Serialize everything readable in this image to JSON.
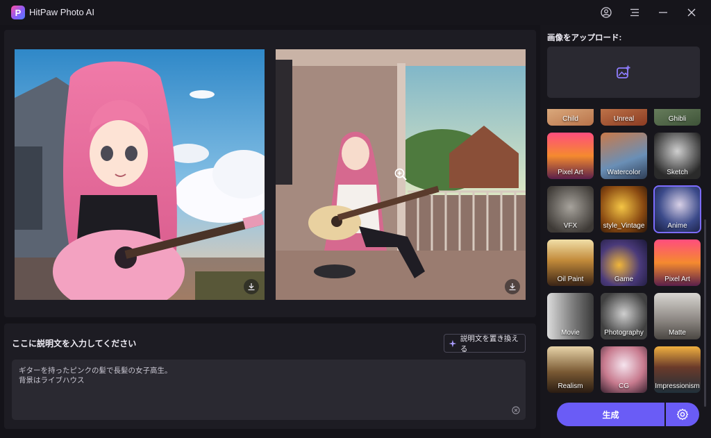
{
  "app": {
    "title": "HitPaw Photo AI",
    "logo_letter": "P"
  },
  "titlebar": {
    "account_icon": "user-circle-icon",
    "menu_icon": "hamburger-menu-icon",
    "minimize_icon": "minimize-icon",
    "close_icon": "close-icon"
  },
  "preview": {
    "left_download_icon": "download-icon",
    "right_download_icon": "download-icon",
    "zoom_icon": "zoom-in-icon"
  },
  "prompt": {
    "label": "ここに説明文を入力してください",
    "replace_button": "説明文を置き換える",
    "lines": [
      "ギターを持ったピンクの髪で長髪の女子高生。",
      "背景はライブハウス"
    ],
    "clear_icon": "clear-circle-icon"
  },
  "upload": {
    "label": "画像をアップロード:",
    "icon": "add-image-icon"
  },
  "styles": [
    {
      "name": "Child"
    },
    {
      "name": "Unreal"
    },
    {
      "name": "Ghibli"
    },
    {
      "name": "Pixel Art"
    },
    {
      "name": "Watercolor"
    },
    {
      "name": "Sketch"
    },
    {
      "name": "VFX"
    },
    {
      "name": "style_Vintage"
    },
    {
      "name": "Anime",
      "selected": true
    },
    {
      "name": "Oil Paint"
    },
    {
      "name": "Game"
    },
    {
      "name": "Pixel Art"
    },
    {
      "name": "Movie"
    },
    {
      "name": "Photography"
    },
    {
      "name": "Matte"
    },
    {
      "name": "Realism"
    },
    {
      "name": "CG"
    },
    {
      "name": "Impressionism"
    }
  ],
  "actions": {
    "generate": "生成",
    "settings_icon": "gear-icon"
  },
  "colors": {
    "accent": "#6a5cf6",
    "background": "#141319",
    "panel": "#1d1c23",
    "field": "#2a2931"
  }
}
